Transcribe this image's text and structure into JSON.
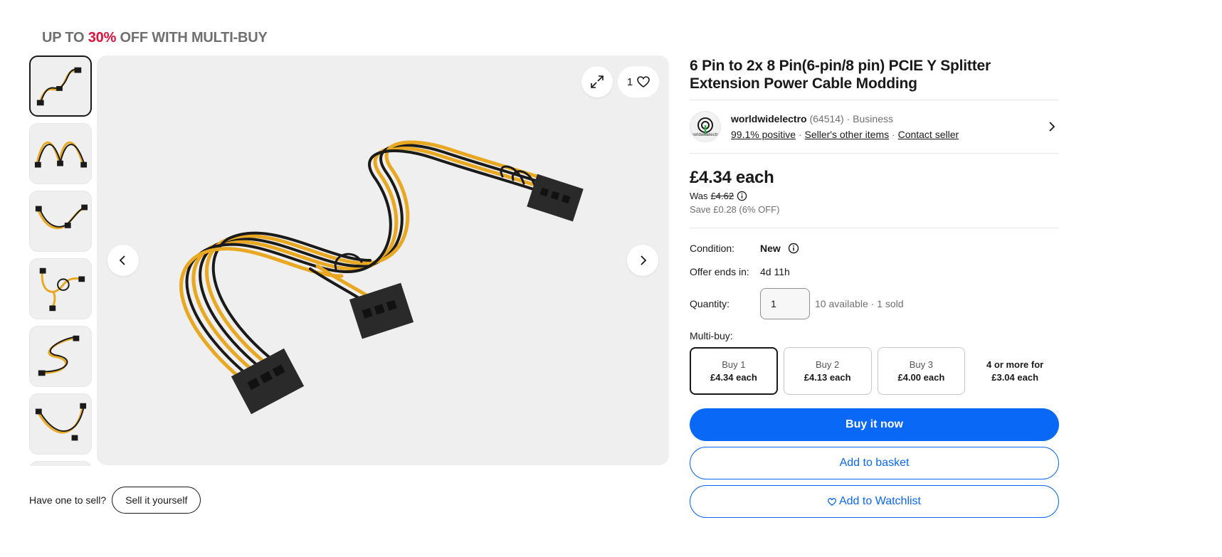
{
  "promo": {
    "prefix": "UP TO ",
    "highlight": "30%",
    "suffix": " OFF WITH MULTI-BUY"
  },
  "gallery": {
    "watch_count": "1",
    "thumbnail_count": 7
  },
  "sell": {
    "prompt": "Have one to sell?",
    "button": "Sell it yourself"
  },
  "product": {
    "title": "6 Pin to 2x 8 Pin(6-pin/8 pin) PCIE Y Splitter Extension Power Cable Modding"
  },
  "seller": {
    "logo_text": "worldwidelectro",
    "name": "worldwidelectro",
    "feedback": "(64514)",
    "type": "· Business",
    "positive": "99.1% positive",
    "other_items": "Seller's other items",
    "contact": "Contact seller",
    "sep": "·"
  },
  "price": {
    "current": "£4.34 each",
    "was_label": "Was",
    "was_value": "£4.62",
    "save": "Save £0.28 (6% OFF)"
  },
  "details": {
    "condition_label": "Condition:",
    "condition_value": "New",
    "offer_label": "Offer ends in:",
    "offer_value": "4d 11h",
    "quantity_label": "Quantity:",
    "quantity_value": "1",
    "availability": "10 available · 1 sold"
  },
  "multibuy": {
    "label": "Multi-buy:",
    "options": [
      {
        "qty": "Buy 1",
        "price": "£4.34 each"
      },
      {
        "qty": "Buy 2",
        "price": "£4.13 each"
      },
      {
        "qty": "Buy 3",
        "price": "£4.00 each"
      }
    ],
    "more_line1": "4 or more for",
    "more_line2": "£3.04 each"
  },
  "actions": {
    "buy_now": "Buy it now",
    "add_basket": "Add to basket",
    "add_watchlist": "Add to Watchlist"
  },
  "colors": {
    "accent": "#0968f6",
    "promo_red": "#e0103a",
    "cable_yellow": "#e8a821",
    "cable_black": "#1a1a1a"
  }
}
